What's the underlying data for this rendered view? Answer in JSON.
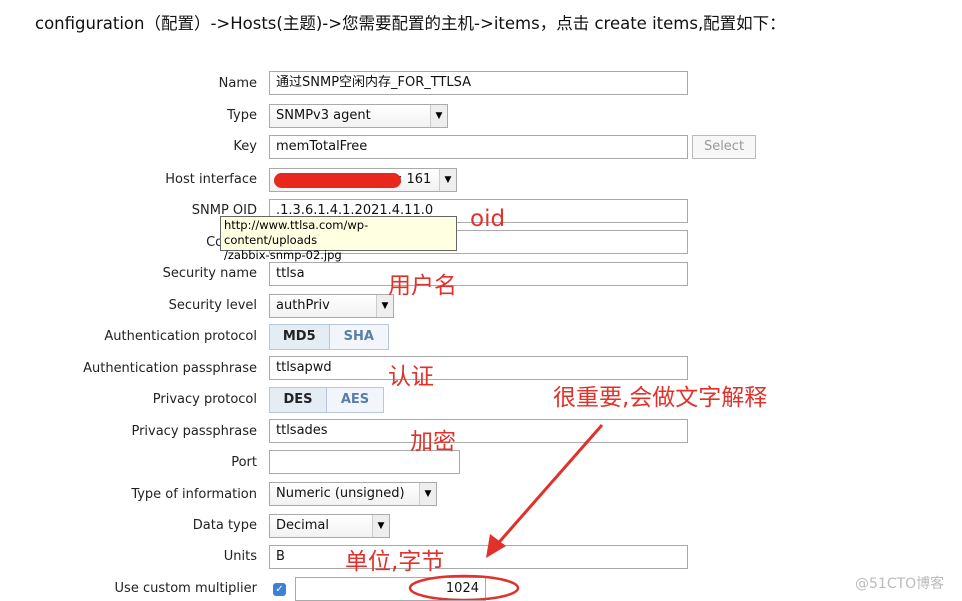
{
  "heading": "configuration（配置）->Hosts(主题)->您需要配置的主机->items，点击 create  items,配置如下：",
  "form": {
    "name": {
      "label": "Name",
      "value": "通过SNMP空闲内存_FOR_TTLSA"
    },
    "type": {
      "label": "Type",
      "value": "SNMPv3 agent"
    },
    "key": {
      "label": "Key",
      "value": "memTotalFree",
      "button": "Select"
    },
    "host_interface": {
      "label": "Host interface",
      "value": ": 161"
    },
    "snmp_oid": {
      "label": "SNMP OID",
      "value": ".1.3.6.1.4.1.2021.4.11.0"
    },
    "context": {
      "label": "Context",
      "value": ""
    },
    "security_name": {
      "label": "Security name",
      "value": "ttlsa"
    },
    "security_level": {
      "label": "Security level",
      "value": "authPriv"
    },
    "auth_protocol": {
      "label": "Authentication protocol",
      "options": [
        "MD5",
        "SHA"
      ],
      "selected": "MD5"
    },
    "auth_passphrase": {
      "label": "Authentication passphrase",
      "value": "ttlsapwd"
    },
    "privacy_protocol": {
      "label": "Privacy protocol",
      "options": [
        "DES",
        "AES"
      ],
      "selected": "DES"
    },
    "privacy_passphrase": {
      "label": "Privacy passphrase",
      "value": "ttlsades"
    },
    "port": {
      "label": "Port",
      "value": ""
    },
    "type_of_information": {
      "label": "Type of information",
      "value": "Numeric (unsigned)"
    },
    "data_type": {
      "label": "Data type",
      "value": "Decimal"
    },
    "units": {
      "label": "Units",
      "value": "B"
    },
    "custom_multiplier": {
      "label": "Use custom multiplier",
      "checked": true,
      "value": "1024"
    }
  },
  "tooltip": {
    "line1": "http://www.ttlsa.com/wp-content/uploads",
    "line2": "/zabbix-snmp-02.jpg"
  },
  "annotations": {
    "oid": "oid",
    "user": "用户名",
    "auth": "认证",
    "important": "很重要,会做文字解释",
    "encrypt": "加密",
    "units": "单位,字节"
  },
  "watermark": "@51CTO博客",
  "colors": {
    "annotation": "#e0322a",
    "redaction": "#e8281c",
    "tooltip_bg": "#ffffe1",
    "checkbox": "#3b82d6"
  }
}
